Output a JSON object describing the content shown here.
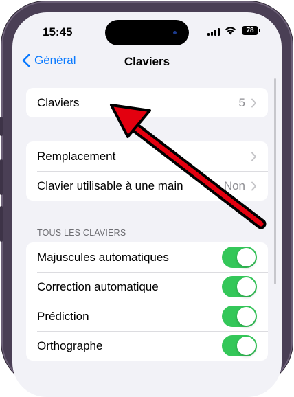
{
  "status": {
    "time": "15:45",
    "battery": "78"
  },
  "nav": {
    "back_label": "Général",
    "title": "Claviers"
  },
  "group1": {
    "rows": [
      {
        "label": "Claviers",
        "value": "5"
      }
    ]
  },
  "group2": {
    "rows": [
      {
        "label": "Remplacement",
        "value": ""
      },
      {
        "label": "Clavier utilisable à une main",
        "value": "Non"
      }
    ]
  },
  "section": {
    "header": "TOUS LES CLAVIERS"
  },
  "toggles": [
    {
      "label": "Majuscules automatiques",
      "on": true
    },
    {
      "label": "Correction automatique",
      "on": true
    },
    {
      "label": "Prédiction",
      "on": true
    },
    {
      "label": "Orthographe",
      "on": true
    }
  ],
  "colors": {
    "accent": "#0a7aff",
    "toggle_on": "#34c759",
    "annotation": "#e3000f"
  }
}
